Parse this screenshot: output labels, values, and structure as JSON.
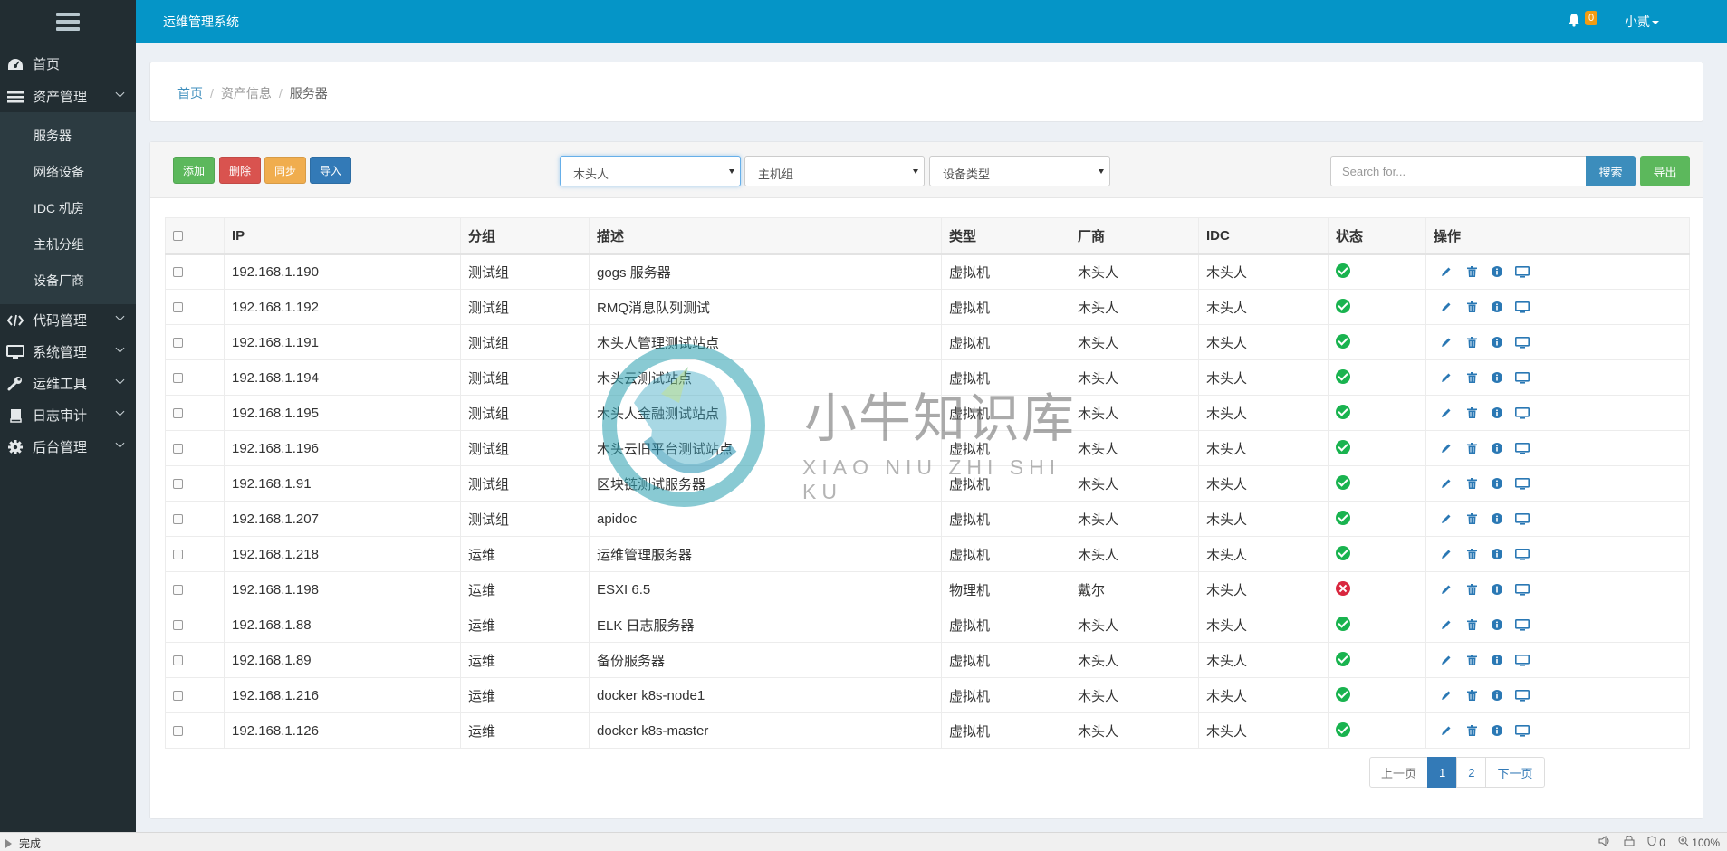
{
  "app": {
    "title": "运维管理系统",
    "notif_count": "0",
    "user": "小贰"
  },
  "sidebar": {
    "home": "首页",
    "asset": "资产管理",
    "asset_sub": [
      "服务器",
      "网络设备",
      "IDC 机房",
      "主机分组",
      "设备厂商"
    ],
    "code": "代码管理",
    "system": "系统管理",
    "tools": "运维工具",
    "audit": "日志审计",
    "admin": "后台管理"
  },
  "breadcrumb": {
    "home": "首页",
    "info": "资产信息",
    "current": "服务器"
  },
  "toolbar": {
    "add": "添加",
    "delete": "删除",
    "sync": "同步",
    "import": "导入",
    "vendor_select": "木头人",
    "group_select": "主机组",
    "type_select": "设备类型",
    "search_placeholder": "Search for...",
    "search": "搜索",
    "export": "导出"
  },
  "table": {
    "headers": {
      "ip": "IP",
      "group": "分组",
      "desc": "描述",
      "type": "类型",
      "vendor": "厂商",
      "idc": "IDC",
      "status": "状态",
      "ops": "操作"
    },
    "rows": [
      {
        "ip": "192.168.1.190",
        "group": "测试组",
        "desc": "gogs 服务器",
        "type": "虚拟机",
        "vendor": "木头人",
        "idc": "木头人",
        "status": "ok"
      },
      {
        "ip": "192.168.1.192",
        "group": "测试组",
        "desc": "RMQ消息队列测试",
        "type": "虚拟机",
        "vendor": "木头人",
        "idc": "木头人",
        "status": "ok"
      },
      {
        "ip": "192.168.1.191",
        "group": "测试组",
        "desc": "木头人管理测试站点",
        "type": "虚拟机",
        "vendor": "木头人",
        "idc": "木头人",
        "status": "ok"
      },
      {
        "ip": "192.168.1.194",
        "group": "测试组",
        "desc": "木头云测试站点",
        "type": "虚拟机",
        "vendor": "木头人",
        "idc": "木头人",
        "status": "ok"
      },
      {
        "ip": "192.168.1.195",
        "group": "测试组",
        "desc": "木头人金融测试站点",
        "type": "虚拟机",
        "vendor": "木头人",
        "idc": "木头人",
        "status": "ok"
      },
      {
        "ip": "192.168.1.196",
        "group": "测试组",
        "desc": "木头云旧平台测试站点",
        "type": "虚拟机",
        "vendor": "木头人",
        "idc": "木头人",
        "status": "ok"
      },
      {
        "ip": "192.168.1.91",
        "group": "测试组",
        "desc": "区块链测试服务器",
        "type": "虚拟机",
        "vendor": "木头人",
        "idc": "木头人",
        "status": "ok"
      },
      {
        "ip": "192.168.1.207",
        "group": "测试组",
        "desc": "apidoc",
        "type": "虚拟机",
        "vendor": "木头人",
        "idc": "木头人",
        "status": "ok"
      },
      {
        "ip": "192.168.1.218",
        "group": "运维",
        "desc": "运维管理服务器",
        "type": "虚拟机",
        "vendor": "木头人",
        "idc": "木头人",
        "status": "ok"
      },
      {
        "ip": "192.168.1.198",
        "group": "运维",
        "desc": "ESXI 6.5",
        "type": "物理机",
        "vendor": "戴尔",
        "idc": "木头人",
        "status": "bad"
      },
      {
        "ip": "192.168.1.88",
        "group": "运维",
        "desc": "ELK 日志服务器",
        "type": "虚拟机",
        "vendor": "木头人",
        "idc": "木头人",
        "status": "ok"
      },
      {
        "ip": "192.168.1.89",
        "group": "运维",
        "desc": "备份服务器",
        "type": "虚拟机",
        "vendor": "木头人",
        "idc": "木头人",
        "status": "ok"
      },
      {
        "ip": "192.168.1.216",
        "group": "运维",
        "desc": "docker k8s-node1",
        "type": "虚拟机",
        "vendor": "木头人",
        "idc": "木头人",
        "status": "ok"
      },
      {
        "ip": "192.168.1.126",
        "group": "运维",
        "desc": "docker k8s-master",
        "type": "虚拟机",
        "vendor": "木头人",
        "idc": "木头人",
        "status": "ok"
      }
    ]
  },
  "pagination": {
    "prev": "上一页",
    "pages": [
      "1",
      "2"
    ],
    "current": "1",
    "next": "下一页"
  },
  "watermark": {
    "cn": "小牛知识库",
    "en": "XIAO NIU ZHI SHI KU"
  },
  "statusbar": {
    "left": "完成",
    "right_zoom": "100%",
    "right_count": "0"
  }
}
